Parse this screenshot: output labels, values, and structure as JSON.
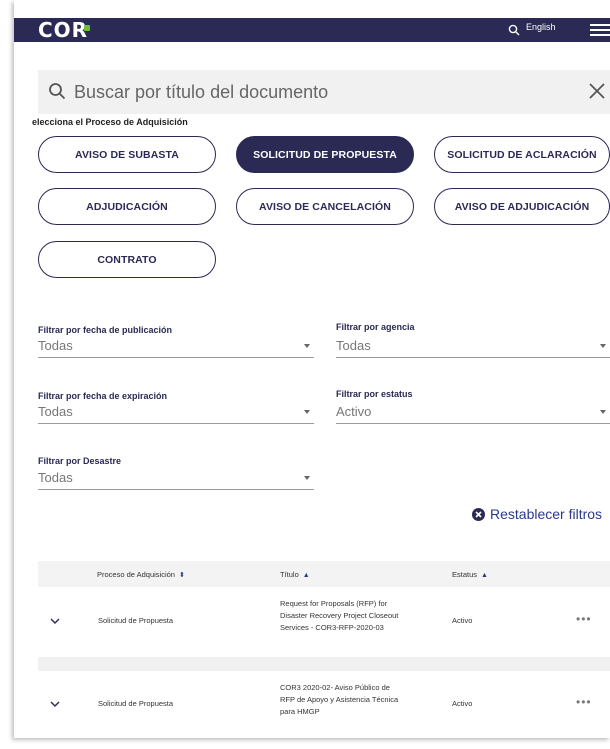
{
  "header": {
    "logo": "COR",
    "language": "English",
    "brand_color": "#2a2a55"
  },
  "search": {
    "placeholder": "Buscar por título del documento"
  },
  "process_section": {
    "label": "elecciona el Proceso de Adquisición",
    "options": [
      {
        "label": "AVISO DE SUBASTA",
        "active": false
      },
      {
        "label": "SOLICITUD DE PROPUESTA",
        "active": true
      },
      {
        "label": "SOLICITUD DE ACLARACIÓN",
        "active": false
      },
      {
        "label": "ADJUDICACIÓN",
        "active": false
      },
      {
        "label": "AVISO DE CANCELACIÓN",
        "active": false
      },
      {
        "label": "AVISO DE ADJUDICACIÓN",
        "active": false
      },
      {
        "label": "CONTRATO",
        "active": false
      }
    ]
  },
  "filters": {
    "pub_date": {
      "label": "Filtrar por fecha de publicación",
      "value": "Todas"
    },
    "agency": {
      "label": "Filtrar por agencia",
      "value": "Todas"
    },
    "exp_date": {
      "label": "Filtrar por fecha de expiración",
      "value": "Todas"
    },
    "status": {
      "label": "Filtrar por estatus",
      "value": "Activo"
    },
    "disaster": {
      "label": "Filtrar por Desastre",
      "value": "Todas"
    }
  },
  "reset": {
    "label": "Restablecer filtros"
  },
  "table": {
    "headers": {
      "process": "Proceso de Adquisición",
      "title": "Título",
      "status": "Estatus"
    },
    "rows": [
      {
        "process": "Solicitud de Propuesta",
        "title_lines": [
          "Request for Proposals (RFP) for",
          "Disaster Recovery Project Closeout",
          "Services - COR3-RFP-2020-03"
        ],
        "status": "Activo",
        "menu": "•••"
      },
      {
        "process": "Solicitud de Propuesta",
        "title_lines": [
          "COR3 2020-02- Aviso Público de",
          "RFP de Apoyo y Asistencia Técnica",
          "para HMGP"
        ],
        "status": "Activo",
        "menu": "•••"
      }
    ]
  }
}
